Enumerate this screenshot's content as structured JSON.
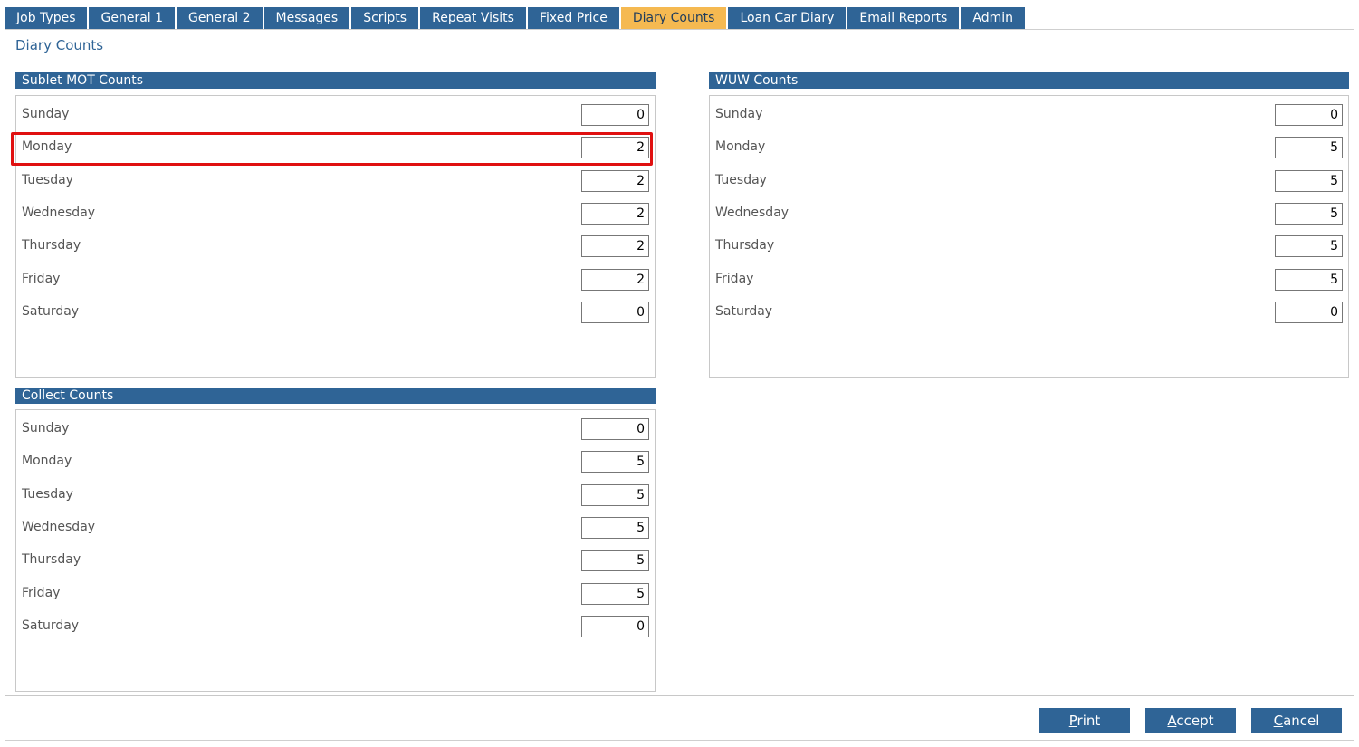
{
  "tabs": [
    "Job Types",
    "General 1",
    "General 2",
    "Messages",
    "Scripts",
    "Repeat Visits",
    "Fixed Price",
    "Diary Counts",
    "Loan Car Diary",
    "Email Reports",
    "Admin"
  ],
  "active_tab": "Diary Counts",
  "page_title": "Diary Counts",
  "sublet_mot": {
    "title": "Sublet MOT Counts",
    "rows": [
      {
        "day": "Sunday",
        "value": "0"
      },
      {
        "day": "Monday",
        "value": "2"
      },
      {
        "day": "Tuesday",
        "value": "2"
      },
      {
        "day": "Wednesday",
        "value": "2"
      },
      {
        "day": "Thursday",
        "value": "2"
      },
      {
        "day": "Friday",
        "value": "2"
      },
      {
        "day": "Saturday",
        "value": "0"
      }
    ]
  },
  "wuw": {
    "title": "WUW Counts",
    "rows": [
      {
        "day": "Sunday",
        "value": "0"
      },
      {
        "day": "Monday",
        "value": "5"
      },
      {
        "day": "Tuesday",
        "value": "5"
      },
      {
        "day": "Wednesday",
        "value": "5"
      },
      {
        "day": "Thursday",
        "value": "5"
      },
      {
        "day": "Friday",
        "value": "5"
      },
      {
        "day": "Saturday",
        "value": "0"
      }
    ]
  },
  "collect": {
    "title": "Collect Counts",
    "rows": [
      {
        "day": "Sunday",
        "value": "0"
      },
      {
        "day": "Monday",
        "value": "5"
      },
      {
        "day": "Tuesday",
        "value": "5"
      },
      {
        "day": "Wednesday",
        "value": "5"
      },
      {
        "day": "Thursday",
        "value": "5"
      },
      {
        "day": "Friday",
        "value": "5"
      },
      {
        "day": "Saturday",
        "value": "0"
      }
    ]
  },
  "buttons": {
    "print": {
      "first": "P",
      "rest": "rint"
    },
    "accept": {
      "first": "A",
      "rest": "ccept"
    },
    "cancel": {
      "first": "C",
      "rest": "ancel"
    }
  },
  "colors": {
    "accent": "#2f6496",
    "active_tab": "#f5b951",
    "highlight": "#e01010"
  }
}
